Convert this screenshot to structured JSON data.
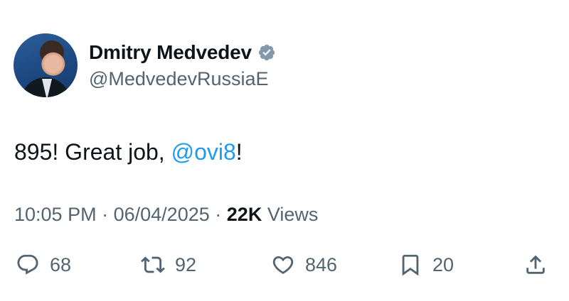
{
  "author": {
    "name": "Dmitry Medvedev",
    "handle": "@MedvedevRussiaE"
  },
  "tweet": {
    "text_before": "895! Great job, ",
    "mention": "@ovi8",
    "text_after": "!"
  },
  "meta": {
    "time": "10:05 PM",
    "separator": "·",
    "date": "06/04/2025",
    "views_count": "22K",
    "views_label": "Views"
  },
  "actions": {
    "replies": "68",
    "reposts": "92",
    "likes": "846",
    "bookmarks": "20"
  },
  "colors": {
    "accent": "#1d9bf0",
    "secondary_text": "#536471",
    "primary_text": "#0f1419"
  },
  "icons": [
    "verified-badge-icon",
    "reply-icon",
    "repost-icon",
    "like-icon",
    "bookmark-icon",
    "share-icon"
  ]
}
